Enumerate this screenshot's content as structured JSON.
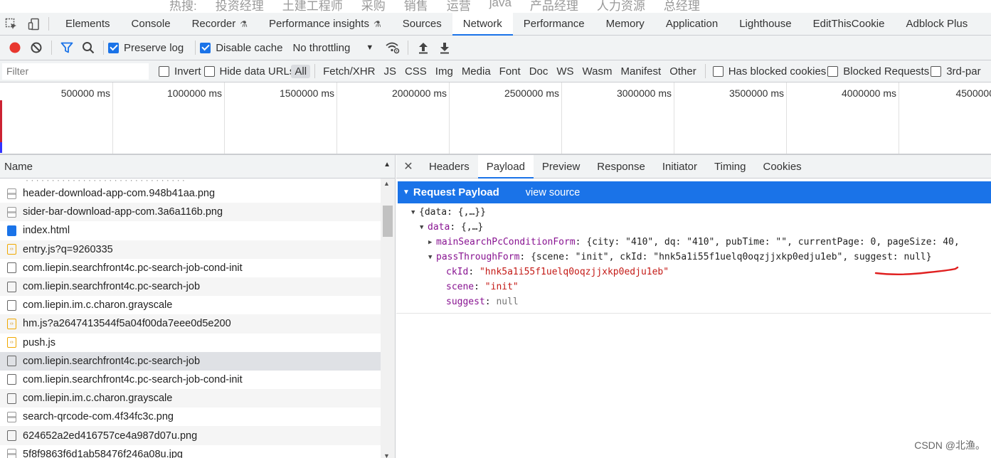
{
  "site_strip": {
    "items": [
      "热搜:",
      "投资经理",
      "土建工程师",
      "采购",
      "销售",
      "运营",
      "java",
      "产品经理",
      "人力资源",
      "总经理"
    ]
  },
  "devtools_tabs": [
    {
      "label": "Elements",
      "active": false,
      "experimental": false
    },
    {
      "label": "Console",
      "active": false,
      "experimental": false
    },
    {
      "label": "Recorder",
      "active": false,
      "experimental": true
    },
    {
      "label": "Performance insights",
      "active": false,
      "experimental": true
    },
    {
      "label": "Sources",
      "active": false,
      "experimental": false
    },
    {
      "label": "Network",
      "active": true,
      "experimental": false
    },
    {
      "label": "Performance",
      "active": false,
      "experimental": false
    },
    {
      "label": "Memory",
      "active": false,
      "experimental": false
    },
    {
      "label": "Application",
      "active": false,
      "experimental": false
    },
    {
      "label": "Lighthouse",
      "active": false,
      "experimental": false
    },
    {
      "label": "EditThisCookie",
      "active": false,
      "experimental": false
    },
    {
      "label": "Adblock Plus",
      "active": false,
      "experimental": false
    }
  ],
  "toolbar": {
    "preserve_log_label": "Preserve log",
    "preserve_log_checked": true,
    "disable_cache_label": "Disable cache",
    "disable_cache_checked": true,
    "throttling_value": "No throttling",
    "record_color": "#e8372e",
    "accent": "#1a73e8"
  },
  "filterbar": {
    "placeholder": "Filter",
    "invert_label": "Invert",
    "hide_data_urls_label": "Hide data URLs",
    "types": [
      "All",
      "Fetch/XHR",
      "JS",
      "CSS",
      "Img",
      "Media",
      "Font",
      "Doc",
      "WS",
      "Wasm",
      "Manifest",
      "Other"
    ],
    "selected_type": "All",
    "has_blocked_cookies_label": "Has blocked cookies",
    "blocked_requests_label": "Blocked Requests",
    "third_party_label": "3rd-par"
  },
  "overview": {
    "ticks": [
      "500000 ms",
      "1000000 ms",
      "1500000 ms",
      "2000000 ms",
      "2500000 ms",
      "3000000 ms",
      "3500000 ms",
      "4000000 ms",
      "4500000"
    ]
  },
  "request_list": {
    "header": "Name",
    "rows": [
      {
        "name": "header-download-app-com.948b41aa.png",
        "icon": "img",
        "selected": false
      },
      {
        "name": "sider-bar-download-app-com.3a6a116b.png",
        "icon": "img",
        "selected": false
      },
      {
        "name": "index.html",
        "icon": "doc",
        "selected": false
      },
      {
        "name": "entry.js?q=9260335",
        "icon": "script",
        "selected": false
      },
      {
        "name": "com.liepin.searchfront4c.pc-search-job-cond-init",
        "icon": "gen",
        "selected": false
      },
      {
        "name": "com.liepin.searchfront4c.pc-search-job",
        "icon": "gen",
        "selected": false
      },
      {
        "name": "com.liepin.im.c.charon.grayscale",
        "icon": "gen",
        "selected": false
      },
      {
        "name": "hm.js?a2647413544f5a04f00da7eee0d5e200",
        "icon": "script",
        "selected": false
      },
      {
        "name": "push.js",
        "icon": "script",
        "selected": false
      },
      {
        "name": "com.liepin.searchfront4c.pc-search-job",
        "icon": "gen",
        "selected": true
      },
      {
        "name": "com.liepin.searchfront4c.pc-search-job-cond-init",
        "icon": "gen",
        "selected": false
      },
      {
        "name": "com.liepin.im.c.charon.grayscale",
        "icon": "gen",
        "selected": false
      },
      {
        "name": "search-qrcode-com.4f34fc3c.png",
        "icon": "img",
        "selected": false
      },
      {
        "name": "624652a2ed416757ce4a987d07u.png",
        "icon": "gen",
        "selected": false
      },
      {
        "name": "5f8f9863f6d1ab58476f246a08u.jpg",
        "icon": "img",
        "selected": false
      }
    ]
  },
  "detail": {
    "tabs": [
      {
        "label": "Headers",
        "active": false
      },
      {
        "label": "Payload",
        "active": true
      },
      {
        "label": "Preview",
        "active": false
      },
      {
        "label": "Response",
        "active": false
      },
      {
        "label": "Initiator",
        "active": false
      },
      {
        "label": "Timing",
        "active": false
      },
      {
        "label": "Cookies",
        "active": false
      }
    ],
    "section_title": "Request Payload",
    "view_source_label": "view source",
    "tree": {
      "root": "{data: {,…}}",
      "data_key": "data",
      "data_summary": "{,…}",
      "msf_key": "mainSearchPcConditionForm",
      "msf_summary": "{city: \"410\", dq: \"410\", pubTime: \"\", currentPage: 0, pageSize: 40,",
      "ptf_key": "passThroughForm",
      "ptf_summary": "{scene: \"init\", ckId: \"hnk5a1i55f1uelq0oqzjjxkp0edju1eb\", suggest: null}",
      "ckid_key": "ckId",
      "ckid_value": "\"hnk5a1i55f1uelq0oqzjjxkp0edju1eb\"",
      "scene_key": "scene",
      "scene_value": "\"init\"",
      "suggest_key": "suggest",
      "suggest_value": "null"
    }
  },
  "watermark": "CSDN @北渔。"
}
